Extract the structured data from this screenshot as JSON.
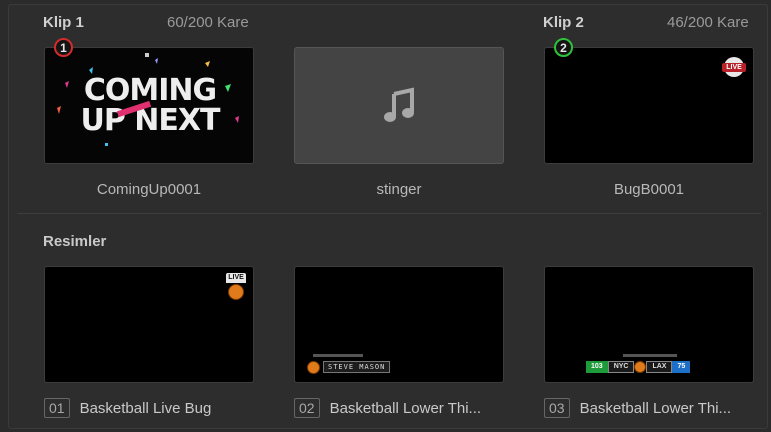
{
  "clips": [
    {
      "title": "Klip 1",
      "count": "60/200 Kare",
      "badge": "1",
      "name": "ComingUp0001",
      "art_line1": "COMING",
      "art_line2": "UP NEXT"
    },
    {
      "name": "stinger",
      "icon": "music-note-icon"
    },
    {
      "title": "Klip 2",
      "count": "46/200 Kare",
      "badge": "2",
      "name": "BugB0001",
      "logo_text": "LIVE"
    }
  ],
  "stills": {
    "section_title": "Resimler",
    "items": [
      {
        "index": "01",
        "name": "Basketball Live Bug",
        "logo_text": "LIVE"
      },
      {
        "index": "02",
        "name": "Basketball Lower Thi...",
        "graphic_text": "STEVE MASON"
      },
      {
        "index": "03",
        "name": "Basketball Lower Thi...",
        "score_left": "103",
        "team_left": "NYC",
        "team_right": "LAX",
        "score_right": "75"
      }
    ]
  },
  "colors": {
    "badge_clip1": "#d22c2c",
    "badge_clip2": "#2ec23a",
    "background": "#2d2d2d"
  }
}
